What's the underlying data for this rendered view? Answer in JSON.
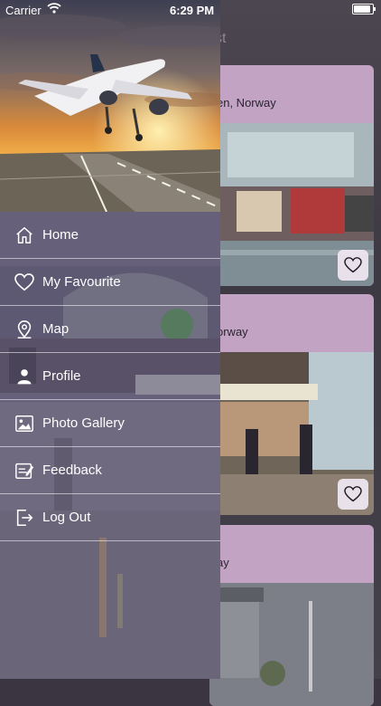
{
  "status_bar": {
    "carrier": "Carrier",
    "time": "6:29 PM"
  },
  "background": {
    "title_fragment": "st",
    "cards": [
      {
        "text": "en, Norway"
      },
      {
        "text": "orway"
      },
      {
        "text": "ay"
      }
    ]
  },
  "drawer": {
    "menu": [
      {
        "label": "Home",
        "icon": "home-icon"
      },
      {
        "label": "My Favourite",
        "icon": "heart-icon"
      },
      {
        "label": "Map",
        "icon": "map-pin-icon"
      },
      {
        "label": "Profile",
        "icon": "person-icon"
      },
      {
        "label": "Photo Gallery",
        "icon": "gallery-icon"
      },
      {
        "label": "Feedback",
        "icon": "feedback-icon"
      },
      {
        "label": "Log Out",
        "icon": "logout-icon"
      }
    ]
  },
  "colors": {
    "card": "#c3a3c4",
    "drawer_tint": "#625c70",
    "text": "#ffffff"
  }
}
